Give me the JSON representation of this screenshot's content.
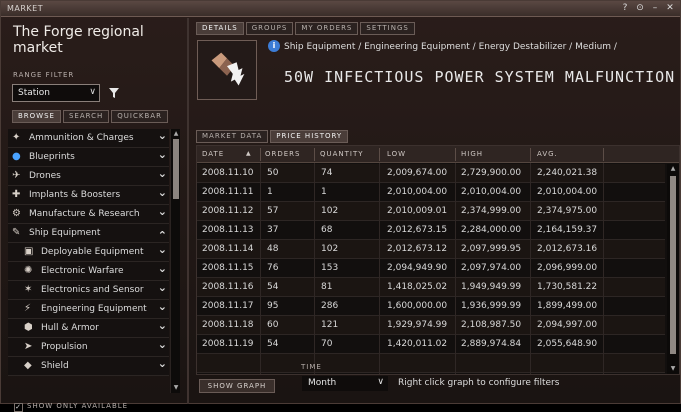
{
  "window": {
    "title": "MARKET",
    "buttons": [
      "?",
      "⊙",
      "–",
      "✕"
    ]
  },
  "left": {
    "region_title": "The Forge regional market",
    "range_filter_label": "RANGE FILTER",
    "range_value": "Station",
    "tabs": [
      "BROWSE",
      "SEARCH",
      "QUICKBAR"
    ],
    "tree": [
      {
        "label": "Ammunition & Charges",
        "icon": "ammo-icon",
        "expanded": false
      },
      {
        "label": "Blueprints",
        "icon": "blueprint-icon",
        "expanded": false
      },
      {
        "label": "Drones",
        "icon": "drone-icon",
        "expanded": false
      },
      {
        "label": "Implants & Boosters",
        "icon": "implant-icon",
        "expanded": false
      },
      {
        "label": "Manufacture & Research",
        "icon": "manufacture-icon",
        "expanded": false
      },
      {
        "label": "Ship Equipment",
        "icon": "ship-equipment-icon",
        "expanded": true
      },
      {
        "label": "Deployable Equipment",
        "icon": "deployable-icon",
        "expanded": false,
        "child": true
      },
      {
        "label": "Electronic Warfare",
        "icon": "ewar-icon",
        "expanded": false,
        "child": true
      },
      {
        "label": "Electronics and Sensor",
        "icon": "sensor-icon",
        "expanded": false,
        "child": true
      },
      {
        "label": "Engineering Equipment",
        "icon": "engineering-icon",
        "expanded": false,
        "child": true
      },
      {
        "label": "Hull & Armor",
        "icon": "armor-icon",
        "expanded": false,
        "child": true
      },
      {
        "label": "Propulsion",
        "icon": "propulsion-icon",
        "expanded": false,
        "child": true
      },
      {
        "label": "Shield",
        "icon": "shield-icon",
        "expanded": false,
        "child": true
      }
    ],
    "show_only_available": "SHOW ONLY AVAILABLE"
  },
  "right": {
    "tabs": [
      "DETAILS",
      "GROUPS",
      "MY ORDERS",
      "SETTINGS"
    ],
    "breadcrumb": "Ship Equipment / Engineering Equipment / Energy Destabilizer / Medium /",
    "item_name": "50W INFECTIOUS POWER SYSTEM MALFUNCTION",
    "subtabs": [
      "MARKET DATA",
      "PRICE HISTORY"
    ],
    "columns": [
      "DATE",
      "ORDERS",
      "QUANTITY",
      "LOW",
      "HIGH",
      "AVG."
    ],
    "rows": [
      [
        "2008.11.10",
        "50",
        "74",
        "2,009,674.00",
        "2,729,900.00",
        "2,240,021.38"
      ],
      [
        "2008.11.11",
        "1",
        "1",
        "2,010,004.00",
        "2,010,004.00",
        "2,010,004.00"
      ],
      [
        "2008.11.12",
        "57",
        "102",
        "2,010,009.01",
        "2,374,999.00",
        "2,374,975.00"
      ],
      [
        "2008.11.13",
        "37",
        "68",
        "2,012,673.15",
        "2,284,000.00",
        "2,164,159.37"
      ],
      [
        "2008.11.14",
        "48",
        "102",
        "2,012,673.12",
        "2,097,999.95",
        "2,012,673.16"
      ],
      [
        "2008.11.15",
        "76",
        "153",
        "2,094,949.90",
        "2,097,974.00",
        "2,096,999.00"
      ],
      [
        "2008.11.16",
        "54",
        "81",
        "1,418,025.02",
        "1,949,949.99",
        "1,730,581.22"
      ],
      [
        "2008.11.17",
        "95",
        "286",
        "1,600,000.00",
        "1,936,999.99",
        "1,899,499.00"
      ],
      [
        "2008.11.18",
        "60",
        "121",
        "1,929,974.99",
        "2,108,987.50",
        "2,094,997.00"
      ],
      [
        "2008.11.19",
        "54",
        "70",
        "1,420,011.02",
        "2,889,974.84",
        "2,055,648.90"
      ],
      [
        "",
        "",
        "",
        "",
        "",
        ""
      ]
    ],
    "show_graph": "SHOW GRAPH",
    "time_label": "TIME",
    "time_value": "Month",
    "hint": "Right click graph to configure filters"
  }
}
